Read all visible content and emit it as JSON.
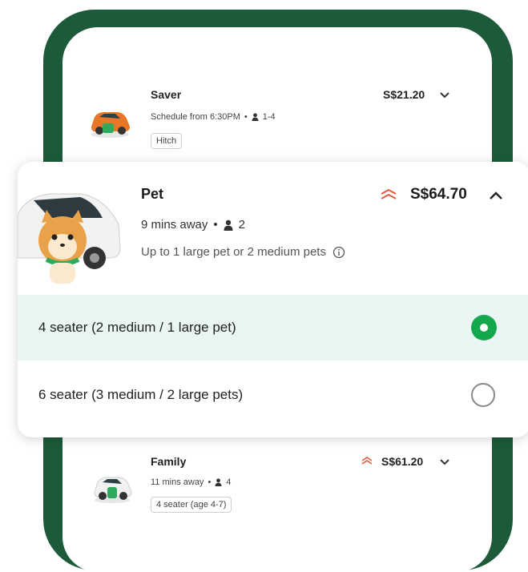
{
  "saver": {
    "title": "Saver",
    "price": "S$21.20",
    "schedule": "Schedule from 6:30PM",
    "seats": "1-4",
    "tag": "Hitch"
  },
  "pet": {
    "title": "Pet",
    "price": "S$64.70",
    "eta": "9 mins away",
    "seats": "2",
    "description": "Up to 1 large pet or 2 medium pets",
    "options": [
      {
        "label": "4 seater (2 medium / 1 large pet)",
        "selected": true
      },
      {
        "label": "6 seater (3 medium / 2 large pets)",
        "selected": false
      }
    ]
  },
  "family": {
    "title": "Family",
    "price": "S$61.20",
    "eta": "11 mins away",
    "seats": "4",
    "tag": "4 seater (age 4-7)"
  },
  "colors": {
    "frame": "#1c5a3a",
    "accent": "#14a84c",
    "surge": "#e8583f",
    "selected_bg": "#eaf6f3"
  }
}
